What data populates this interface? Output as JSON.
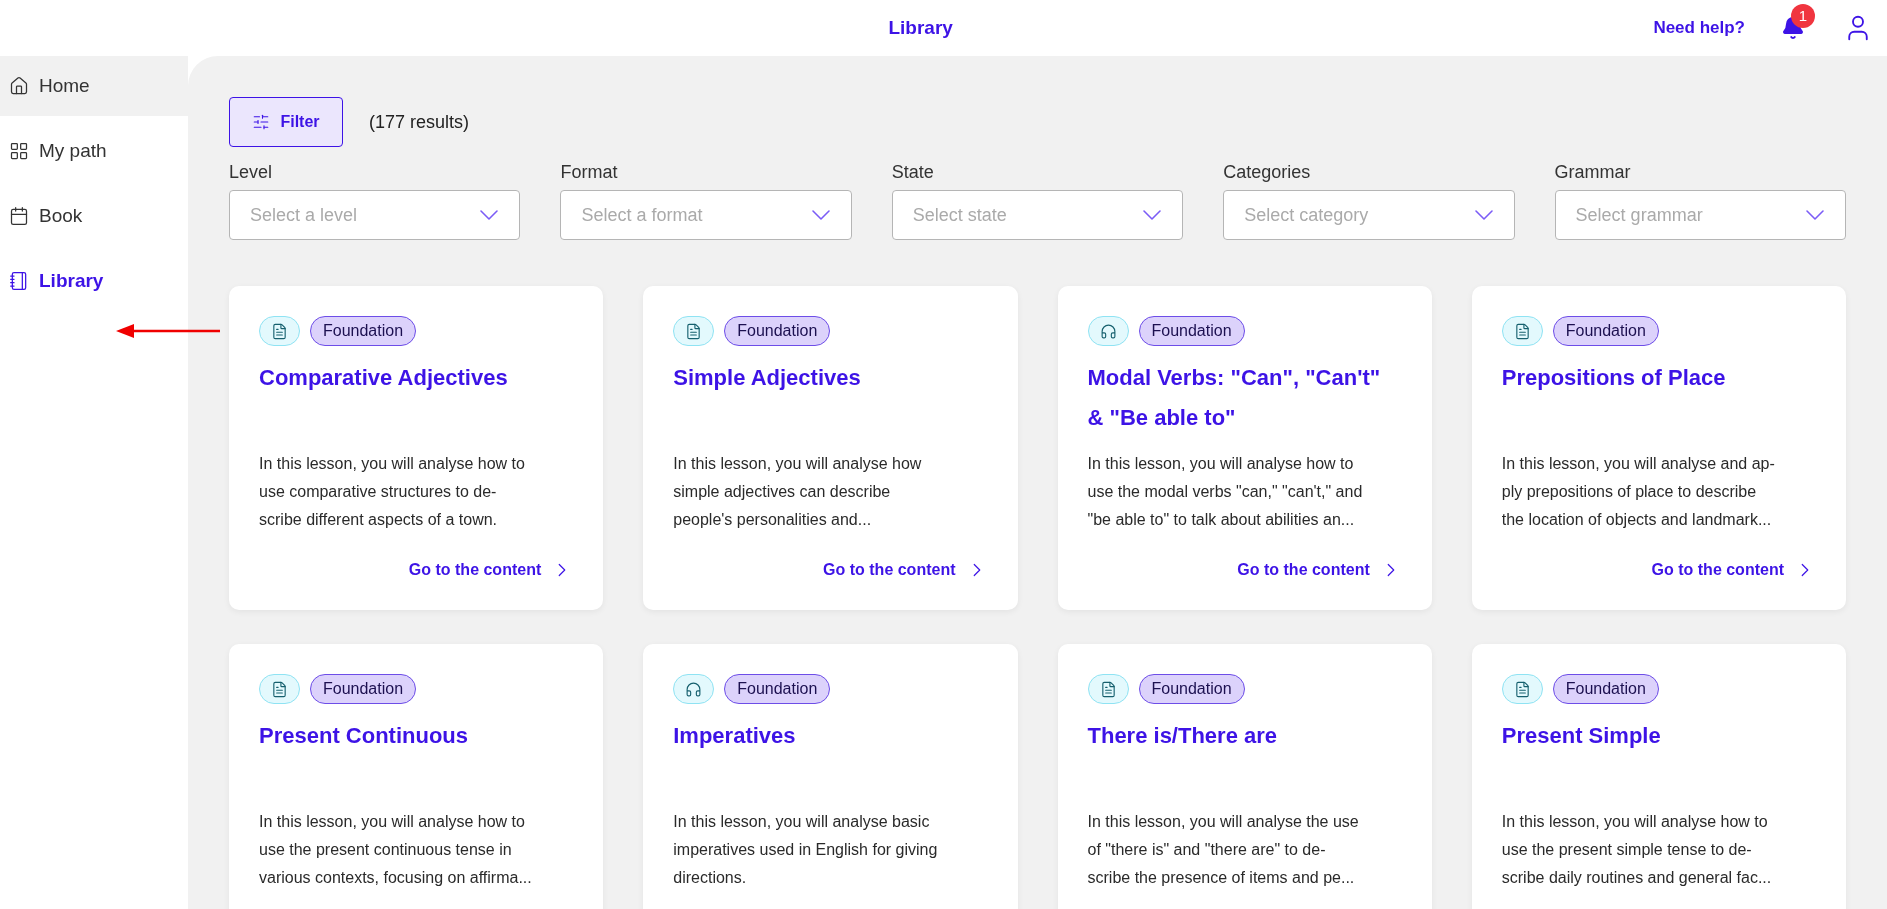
{
  "header": {
    "title": "Library",
    "help": "Need help?",
    "notifications": "1"
  },
  "sidebar": {
    "items": [
      {
        "label": "Home",
        "kind": "home",
        "selected": false,
        "hovered": true
      },
      {
        "label": "My path",
        "kind": "path",
        "selected": false,
        "hovered": false
      },
      {
        "label": "Book",
        "kind": "book",
        "selected": false,
        "hovered": false
      },
      {
        "label": "Library",
        "kind": "library",
        "selected": true,
        "hovered": false
      }
    ]
  },
  "annotation": {
    "kind": "arrow"
  },
  "filter": {
    "button": "Filter",
    "results": "(177 results)"
  },
  "dropdowns": [
    {
      "label": "Level",
      "placeholder": "Select a level"
    },
    {
      "label": "Format",
      "placeholder": "Select a format"
    },
    {
      "label": "State",
      "placeholder": "Select state"
    },
    {
      "label": "Categories",
      "placeholder": "Select category"
    },
    {
      "label": "Grammar",
      "placeholder": "Select grammar"
    }
  ],
  "cards": [
    {
      "kind": "document",
      "tag": "Foundation",
      "title": "Comparative Adjectives",
      "description": [
        "In this lesson, you will analyse how to",
        "use comparative structures to de-",
        "scribe different aspects of a town."
      ],
      "link": "Go to the content"
    },
    {
      "kind": "document",
      "tag": "Foundation",
      "title": "Simple Adjectives",
      "description": [
        "In this lesson, you will analyse how",
        "simple adjectives can describe",
        "people's personalities and..."
      ],
      "link": "Go to the content"
    },
    {
      "kind": "audio",
      "tag": "Foundation",
      "title": "Modal Verbs: \"Can\", \"Can't\" & \"Be able to\"",
      "description": [
        "In this lesson, you will analyse how to",
        "use the modal verbs \"can,\" \"can't,\" and",
        "\"be able to\" to talk about abilities an..."
      ],
      "link": "Go to the content"
    },
    {
      "kind": "document",
      "tag": "Foundation",
      "title": "Prepositions of Place",
      "description": [
        "In this lesson, you will analyse and ap-",
        "ply prepositions of place to describe",
        "the location of objects and landmark..."
      ],
      "link": "Go to the content"
    },
    {
      "kind": "document",
      "tag": "Foundation",
      "title": "Present Continuous",
      "description": [
        "In this lesson, you will analyse how to",
        "use the present continuous tense in",
        "various contexts, focusing on affirma..."
      ]
    },
    {
      "kind": "audio",
      "tag": "Foundation",
      "title": "Imperatives",
      "description": [
        "In this lesson, you will analyse basic",
        "imperatives used in English for giving",
        "directions."
      ]
    },
    {
      "kind": "document",
      "tag": "Foundation",
      "title": "There is/There are",
      "description": [
        "In this lesson, you will analyse the use",
        "of \"there is\" and \"there are\" to de-",
        "scribe the presence of items and pe..."
      ]
    },
    {
      "kind": "document",
      "tag": "Foundation",
      "title": "Present Simple",
      "description": [
        "In this lesson, you will analyse how to",
        "use the present simple tense to de-",
        "scribe daily routines and general fac..."
      ]
    }
  ]
}
